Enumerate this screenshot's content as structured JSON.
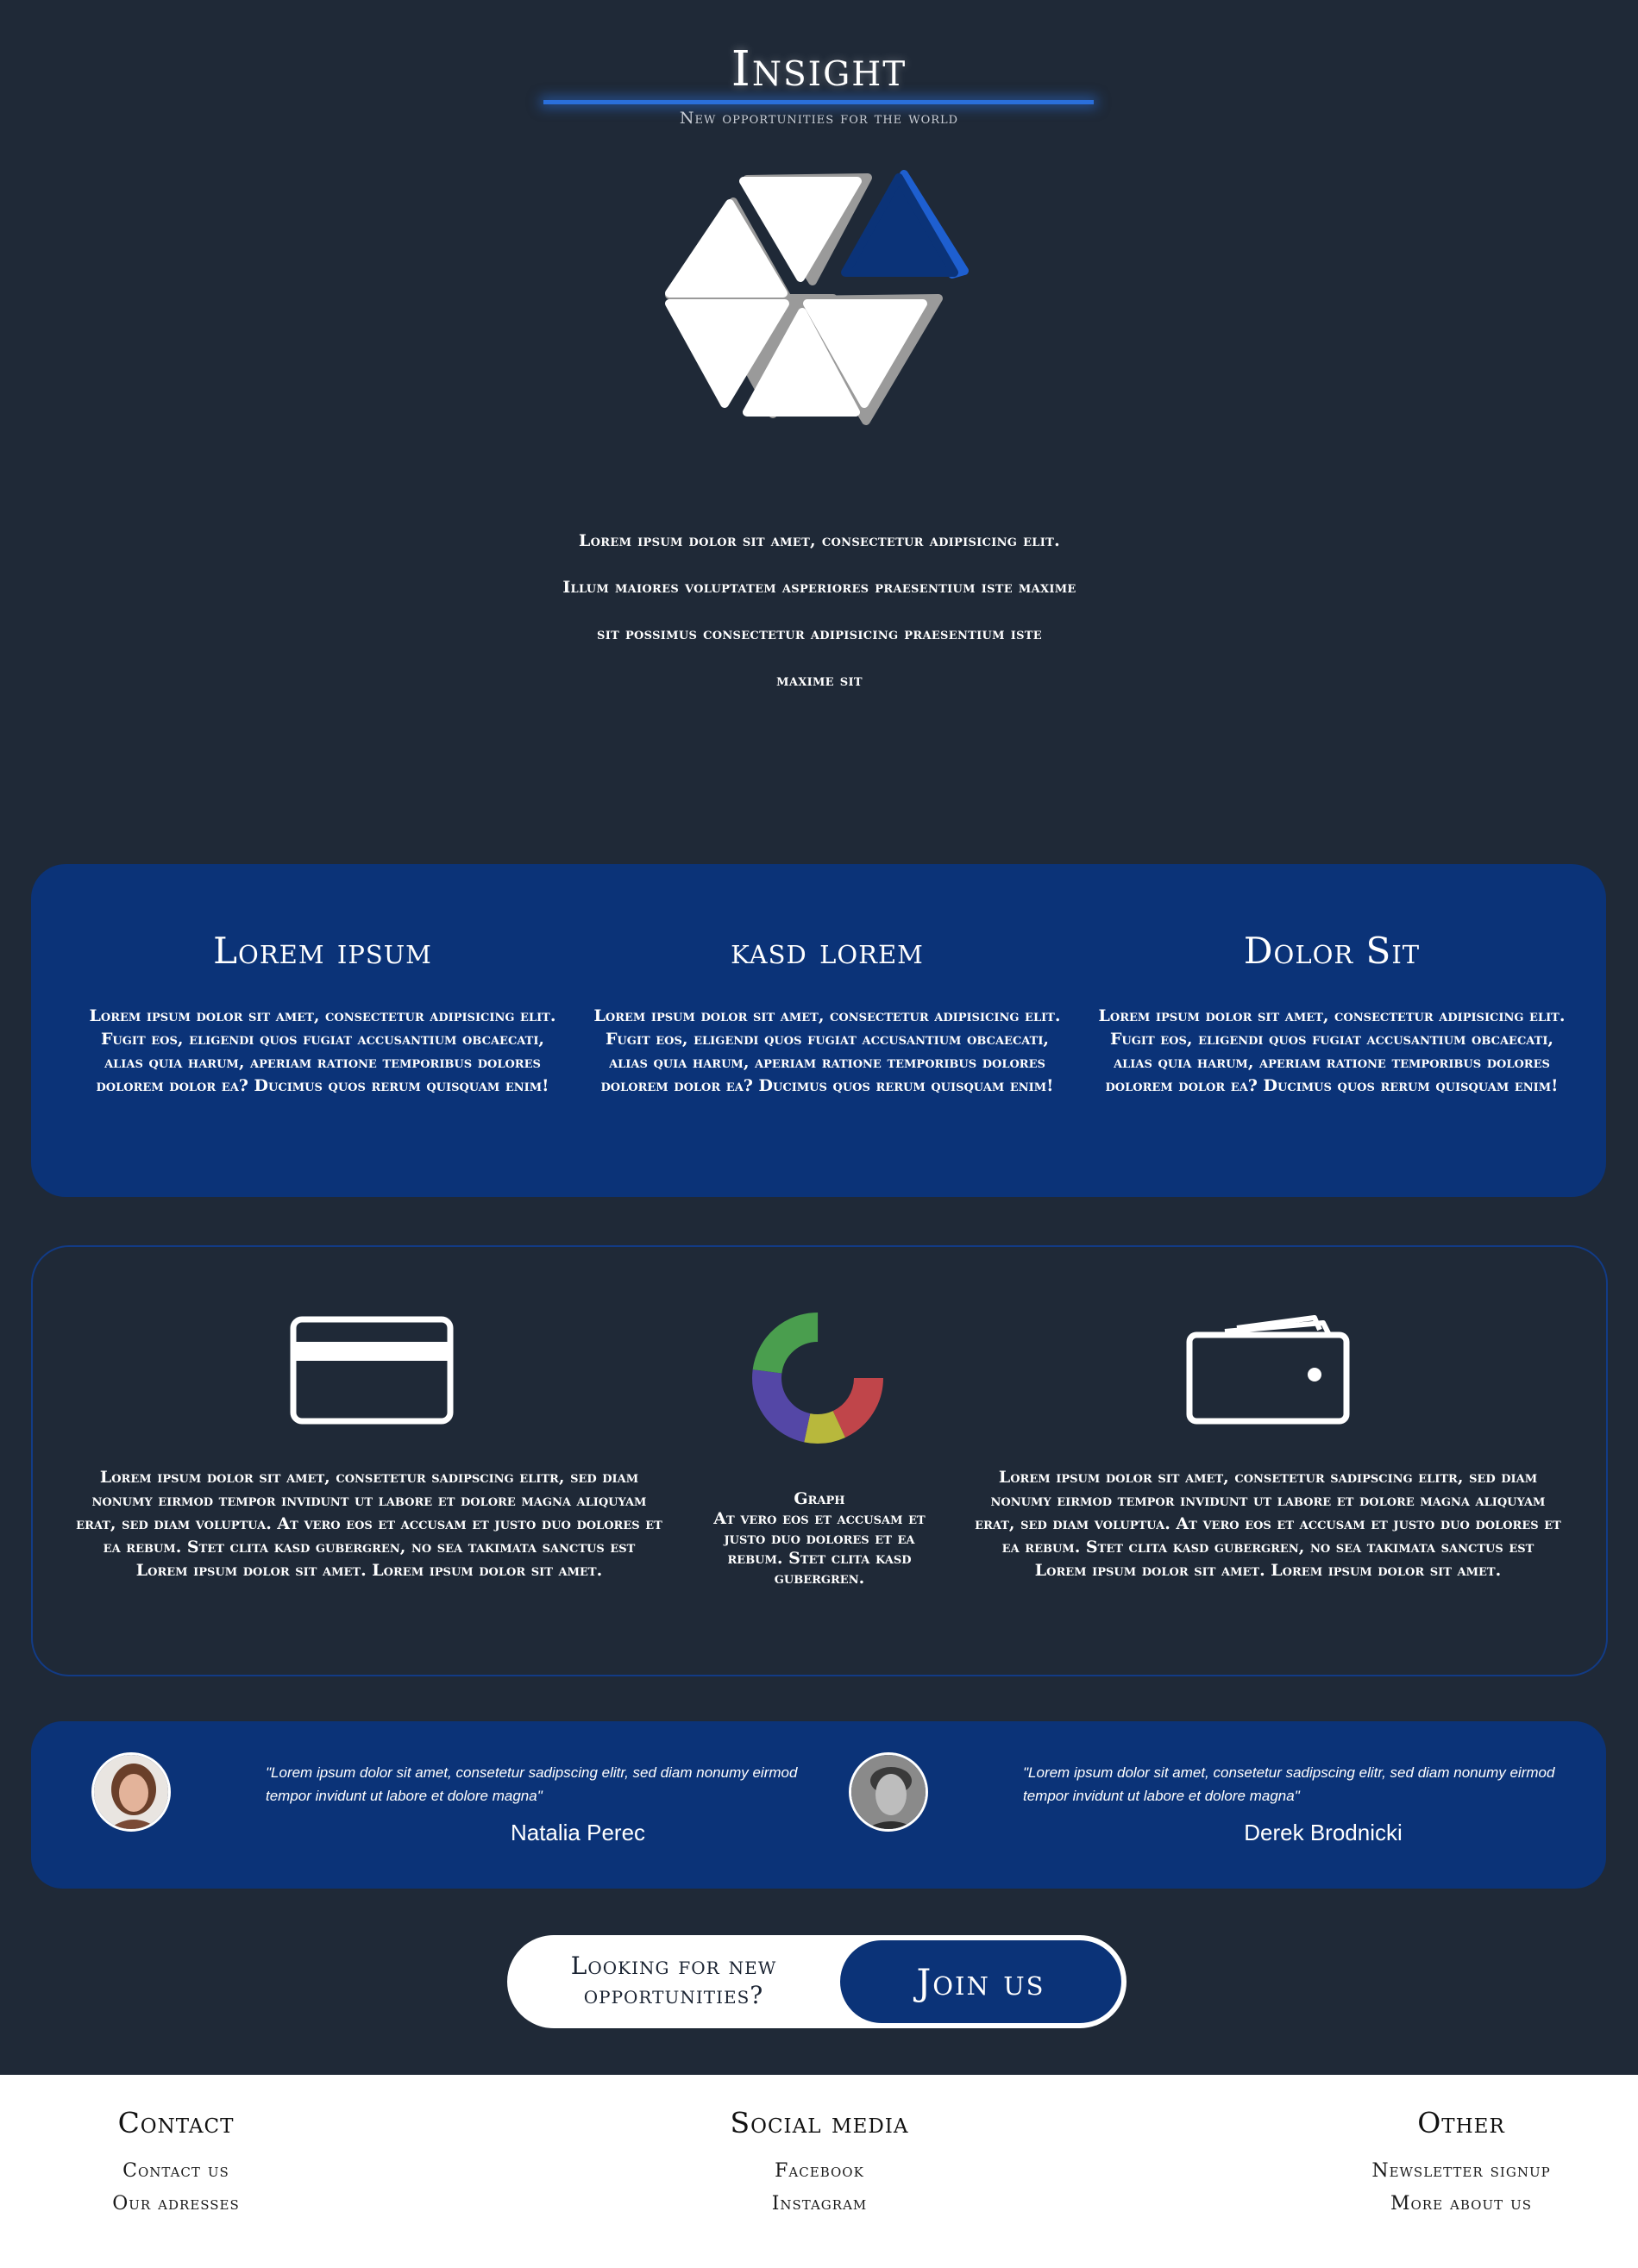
{
  "header": {
    "title": "Insight",
    "subtitle": "New opportunities for the world"
  },
  "intro": {
    "lines": [
      "Lorem ipsum dolor sit amet, consectetur adipisicing elit.",
      "Illum maiores voluptatem asperiores praesentium iste maxime",
      "sit possimus consectetur adipisicing praesentium iste",
      "maxime sit"
    ]
  },
  "features": [
    {
      "title": "Lorem ipsum",
      "text": "Lorem ipsum dolor sit amet, consectetur adipisicing elit. Fugit eos, eligendi quos fugiat accusantium obcaecati, alias quia harum, aperiam ratione temporibus dolores dolorem dolor ea? Ducimus quos rerum quisquam enim!"
    },
    {
      "title": "kasd lorem",
      "text": "Lorem ipsum dolor sit amet, consectetur adipisicing elit. Fugit eos, eligendi quos fugiat accusantium obcaecati, alias quia harum, aperiam ratione temporibus dolores dolorem dolor ea? Ducimus quos rerum quisquam enim!"
    },
    {
      "title": "Dolor Sit",
      "text": "Lorem ipsum dolor sit amet, consectetur adipisicing elit. Fugit eos, eligendi quos fugiat accusantium obcaecati, alias quia harum, aperiam ratione temporibus dolores dolorem dolor ea? Ducimus quos rerum quisquam enim!"
    }
  ],
  "icons_band": {
    "left": {
      "icon": "credit-card-icon",
      "text": "Lorem ipsum dolor sit amet, consetetur sadipscing elitr, sed diam nonumy eirmod tempor invidunt ut labore et dolore magna aliquyam erat, sed diam voluptua. At vero eos et accusam et justo duo dolores et ea rebum. Stet clita kasd gubergren, no sea takimata sanctus est Lorem ipsum dolor sit amet. Lorem ipsum dolor sit amet."
    },
    "center": {
      "icon": "donut-chart-icon",
      "title": "Graph",
      "text": "At vero eos et accusam et justo duo dolores et ea rebum. Stet clita kasd gubergren."
    },
    "right": {
      "icon": "wallet-icon",
      "text": "Lorem ipsum dolor sit amet, consetetur sadipscing elitr, sed diam nonumy eirmod tempor invidunt ut labore et dolore magna aliquyam erat, sed diam voluptua. At vero eos et accusam et justo duo dolores et ea rebum. Stet clita kasd gubergren, no sea takimata sanctus est Lorem ipsum dolor sit amet. Lorem ipsum dolor sit amet."
    }
  },
  "testimonials": [
    {
      "quote": "\"Lorem ipsum dolor sit amet, consetetur sadipscing elitr, sed diam nonumy eirmod tempor invidunt ut labore et dolore magna\"",
      "name": "Natalia Perec"
    },
    {
      "quote": "\"Lorem ipsum dolor sit amet, consetetur sadipscing elitr, sed diam nonumy eirmod tempor invidunt ut labore et dolore magna\"",
      "name": "Derek Brodnicki"
    }
  ],
  "cta": {
    "text_line1": "Looking for new",
    "text_line2": "opportunities?",
    "button": "Join us"
  },
  "footer": {
    "contact": {
      "heading": "Contact",
      "links": [
        "Contact us",
        "Our adresses"
      ]
    },
    "social": {
      "heading": "Social media",
      "links": [
        "Facebook",
        "Instagram"
      ]
    },
    "other": {
      "heading": "Other",
      "links": [
        "Newsletter signup",
        "More about us"
      ]
    }
  },
  "colors": {
    "background": "#1f2937",
    "brand_blue": "#0b3378",
    "accent_line": "#2a6fdb",
    "donut_red": "#c0454a",
    "donut_green": "#4a9e4e",
    "donut_purple": "#5447a6",
    "donut_yellow": "#b8b83c"
  }
}
